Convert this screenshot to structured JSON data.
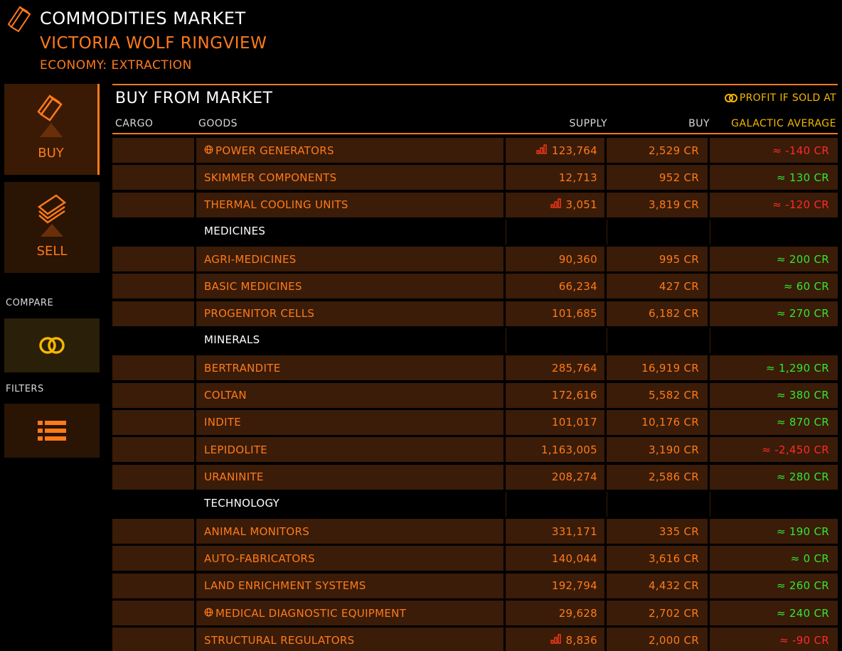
{
  "header": {
    "title": "COMMODITIES MARKET",
    "station": "VICTORIA WOLF RINGVIEW",
    "economy": "ECONOMY: EXTRACTION",
    "icon": "commodity-canister-icon"
  },
  "sidebar": {
    "buy_label": "BUY",
    "sell_label": "SELL",
    "compare_caption": "COMPARE",
    "filters_caption": "FILTERS"
  },
  "panel": {
    "title": "BUY FROM MARKET",
    "profit_label": "PROFIT IF SOLD AT",
    "columns": {
      "cargo": "CARGO",
      "goods": "GOODS",
      "supply": "SUPPLY",
      "buy": "BUY",
      "avg": "GALACTIC AVERAGE"
    }
  },
  "colors": {
    "accent": "#ff7a1a",
    "row_bg": "#3a1c08",
    "profit_positive": "#33e633",
    "profit_negative": "#ff2a2a",
    "compare_gold": "#f5b800"
  },
  "rows": [
    {
      "type": "item",
      "goods": "POWER GENERATORS",
      "rare_icon": true,
      "supply_icon": true,
      "supply": "123,764",
      "buy": "2,529 CR",
      "avg": "≈ -140 CR",
      "profit": "negative"
    },
    {
      "type": "item",
      "goods": "SKIMMER COMPONENTS",
      "rare_icon": false,
      "supply_icon": false,
      "supply": "12,713",
      "buy": "952 CR",
      "avg": "≈ 130 CR",
      "profit": "positive"
    },
    {
      "type": "item",
      "goods": "THERMAL COOLING UNITS",
      "rare_icon": false,
      "supply_icon": true,
      "supply": "3,051",
      "buy": "3,819 CR",
      "avg": "≈ -120 CR",
      "profit": "negative"
    },
    {
      "type": "category",
      "goods": "MEDICINES"
    },
    {
      "type": "item",
      "goods": "AGRI-MEDICINES",
      "rare_icon": false,
      "supply_icon": false,
      "supply": "90,360",
      "buy": "995 CR",
      "avg": "≈ 200 CR",
      "profit": "positive"
    },
    {
      "type": "item",
      "goods": "BASIC MEDICINES",
      "rare_icon": false,
      "supply_icon": false,
      "supply": "66,234",
      "buy": "427 CR",
      "avg": "≈ 60 CR",
      "profit": "positive"
    },
    {
      "type": "item",
      "goods": "PROGENITOR CELLS",
      "rare_icon": false,
      "supply_icon": false,
      "supply": "101,685",
      "buy": "6,182 CR",
      "avg": "≈ 270 CR",
      "profit": "positive"
    },
    {
      "type": "category",
      "goods": "MINERALS"
    },
    {
      "type": "item",
      "goods": "BERTRANDITE",
      "rare_icon": false,
      "supply_icon": false,
      "supply": "285,764",
      "buy": "16,919 CR",
      "avg": "≈ 1,290 CR",
      "profit": "positive"
    },
    {
      "type": "item",
      "goods": "COLTAN",
      "rare_icon": false,
      "supply_icon": false,
      "supply": "172,616",
      "buy": "5,582 CR",
      "avg": "≈ 380 CR",
      "profit": "positive"
    },
    {
      "type": "item",
      "goods": "INDITE",
      "rare_icon": false,
      "supply_icon": false,
      "supply": "101,017",
      "buy": "10,176 CR",
      "avg": "≈ 870 CR",
      "profit": "positive"
    },
    {
      "type": "item",
      "goods": "LEPIDOLITE",
      "rare_icon": false,
      "supply_icon": false,
      "supply": "1,163,005",
      "buy": "3,190 CR",
      "avg": "≈ -2,450 CR",
      "profit": "negative"
    },
    {
      "type": "item",
      "goods": "URANINITE",
      "rare_icon": false,
      "supply_icon": false,
      "supply": "208,274",
      "buy": "2,586 CR",
      "avg": "≈ 280 CR",
      "profit": "positive"
    },
    {
      "type": "category",
      "goods": "TECHNOLOGY"
    },
    {
      "type": "item",
      "goods": "ANIMAL MONITORS",
      "rare_icon": false,
      "supply_icon": false,
      "supply": "331,171",
      "buy": "335 CR",
      "avg": "≈ 190 CR",
      "profit": "positive"
    },
    {
      "type": "item",
      "goods": "AUTO-FABRICATORS",
      "rare_icon": false,
      "supply_icon": false,
      "supply": "140,044",
      "buy": "3,616 CR",
      "avg": "≈ 0 CR",
      "profit": "positive"
    },
    {
      "type": "item",
      "goods": "LAND ENRICHMENT SYSTEMS",
      "rare_icon": false,
      "supply_icon": false,
      "supply": "192,794",
      "buy": "4,432 CR",
      "avg": "≈ 260 CR",
      "profit": "positive"
    },
    {
      "type": "item",
      "goods": "MEDICAL DIAGNOSTIC EQUIPMENT",
      "rare_icon": true,
      "supply_icon": false,
      "supply": "29,628",
      "buy": "2,702 CR",
      "avg": "≈ 240 CR",
      "profit": "positive"
    },
    {
      "type": "item",
      "goods": "STRUCTURAL REGULATORS",
      "rare_icon": false,
      "supply_icon": true,
      "supply": "8,836",
      "buy": "2,000 CR",
      "avg": "≈ -90 CR",
      "profit": "negative"
    }
  ]
}
